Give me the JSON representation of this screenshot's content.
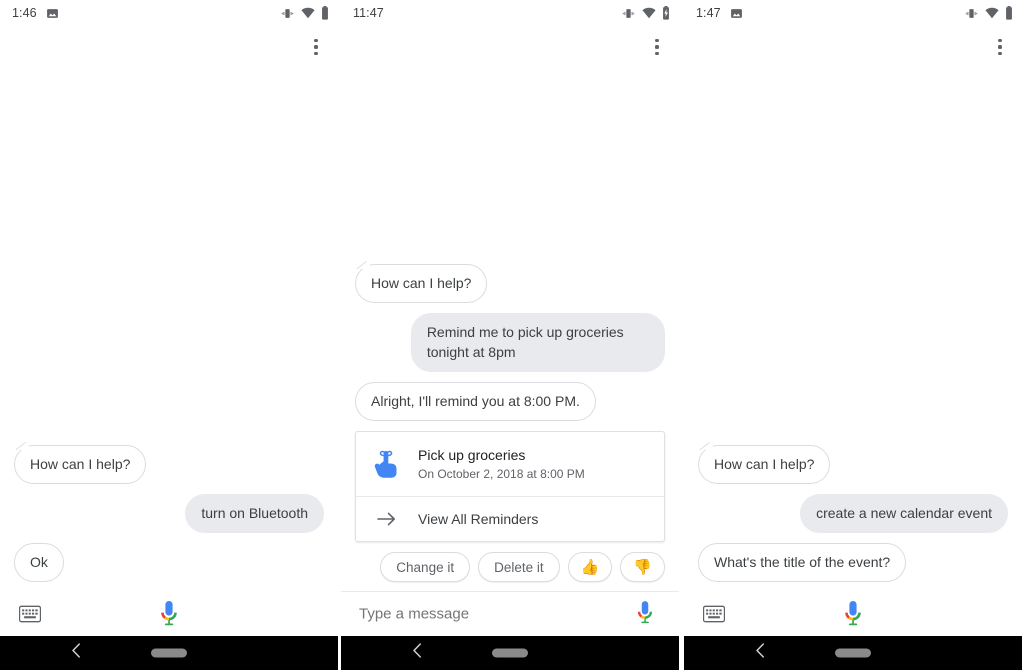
{
  "panels": [
    {
      "id": "left",
      "status": {
        "time": "1:46",
        "left_icons": [
          "image-icon"
        ],
        "right_icons": [
          "vibrate-icon",
          "wifi-icon",
          "battery-icon"
        ]
      },
      "overflow_label": "more-options",
      "messages": [
        {
          "from": "assistant",
          "text": "How can I help?"
        },
        {
          "from": "user",
          "text": "turn on Bluetooth"
        },
        {
          "from": "assistant",
          "text": "Ok"
        }
      ],
      "bottom": {
        "mode": "voice",
        "keyboard_icon": "keyboard-icon",
        "mic_icon": "google-mic-icon"
      },
      "nav": {
        "back_icon": "back-chevron-icon",
        "home_icon": "home-pill-icon"
      }
    },
    {
      "id": "mid",
      "status": {
        "time": "11:47",
        "left_icons": [],
        "right_icons": [
          "vibrate-icon",
          "wifi-icon",
          "battery-charging-icon"
        ]
      },
      "overflow_label": "more-options",
      "messages": [
        {
          "from": "assistant",
          "text": "How can I help?"
        },
        {
          "from": "user",
          "text": "Remind me to pick up groceries tonight at 8pm"
        },
        {
          "from": "assistant",
          "text": "Alright, I'll remind you at 8:00 PM."
        }
      ],
      "card": {
        "icon": "reminder-hand-icon",
        "title": "Pick up groceries",
        "subtitle": "On October 2, 2018 at 8:00 PM",
        "action_icon": "arrow-right-icon",
        "action_label": "View All Reminders"
      },
      "chips": [
        {
          "label": "Change it",
          "type": "text"
        },
        {
          "label": "Delete it",
          "type": "text"
        },
        {
          "label": "👍",
          "type": "emoji",
          "name": "thumbs-up"
        },
        {
          "label": "👎",
          "type": "emoji",
          "name": "thumbs-down"
        }
      ],
      "bottom": {
        "mode": "text",
        "placeholder": "Type a message",
        "value": "",
        "mic_icon": "google-mic-icon"
      },
      "nav": {
        "back_icon": "back-chevron-icon",
        "home_icon": "home-pill-icon"
      }
    },
    {
      "id": "right",
      "status": {
        "time": "1:47",
        "left_icons": [
          "image-icon"
        ],
        "right_icons": [
          "vibrate-icon",
          "wifi-icon",
          "battery-icon"
        ]
      },
      "overflow_label": "more-options",
      "messages": [
        {
          "from": "assistant",
          "text": "How can I help?"
        },
        {
          "from": "user",
          "text": "create a new calendar event"
        },
        {
          "from": "assistant",
          "text": "What's the title of the event?"
        }
      ],
      "bottom": {
        "mode": "voice",
        "keyboard_icon": "keyboard-icon",
        "mic_icon": "google-mic-icon"
      },
      "nav": {
        "back_icon": "back-chevron-icon",
        "home_icon": "home-pill-icon"
      }
    }
  ],
  "colors": {
    "assistant_bubble_bg": "#ffffff",
    "assistant_bubble_border": "#dadce0",
    "user_bubble_bg": "#e8eaed",
    "text_primary": "#3c4043",
    "text_secondary": "#5f6368",
    "mic_blue": "#4285f4",
    "mic_red": "#ea4335",
    "mic_yellow": "#fbbc05",
    "mic_green": "#34a853",
    "reminder_icon_blue": "#4285f4",
    "navbar_bg": "#000000"
  }
}
